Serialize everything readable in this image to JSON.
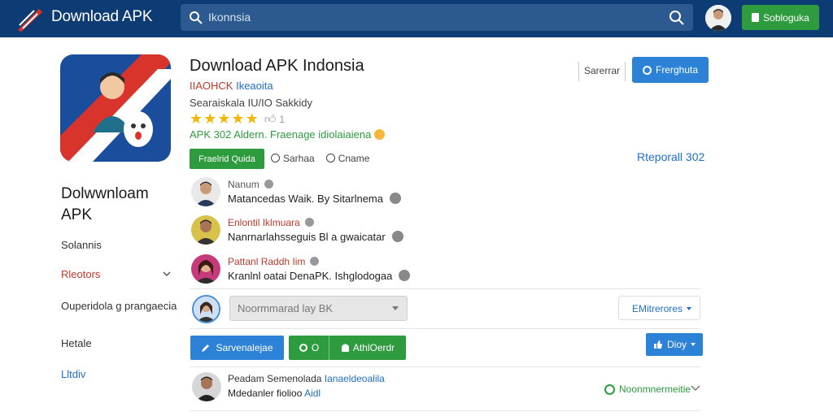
{
  "header": {
    "brand": "Download APK",
    "search_placeholder": "Ikonnsia",
    "account_button": "Sobloguka"
  },
  "app": {
    "title": "Download APK Indonsia",
    "developer_red": "IIAOHCK",
    "developer_blue": "Ikeaoita",
    "meta": "Searaiskala IU/IO Sakkidy",
    "rating_count": "1",
    "tagline": "APK 302 Aldern. Fraenage idiolaiaiena",
    "install_button": "Fraelrid Quida",
    "option_1": "Sarhaa",
    "option_2": "Cname",
    "sort_label": "Sarerrar",
    "primary_button": "Frerghuta",
    "report_link": "Rteporall 302"
  },
  "sidebar": {
    "title": "Dolwwnloam APK",
    "items": [
      {
        "label": "Solannis",
        "color": "default"
      },
      {
        "label": "Rleotors",
        "color": "red"
      },
      {
        "label": "Ouperidola g prangaecia",
        "color": "default"
      },
      {
        "label": "Hetale",
        "color": "default"
      },
      {
        "label": "Lltdiv",
        "color": "blue"
      }
    ]
  },
  "comments": [
    {
      "name": "Nanum",
      "text": "Matancedas Waik. By Sitarlnema",
      "name_color": "default"
    },
    {
      "name": "Enlontil Iklmuara",
      "text": "Nanrnarlahsseguis Bl a gwaicatar",
      "name_color": "red"
    },
    {
      "name": "Pattanl Raddh Iim",
      "text": "Kranlnl oatai DenaPK. Ishglodogaa",
      "name_color": "red"
    }
  ],
  "compose": {
    "select_value": "Noormmarad lay BK",
    "filter_button": "EMitrerores"
  },
  "actions": {
    "blue_button": "Sarvenalejae",
    "green_seg_1": "O",
    "green_seg_2": "AthlOerdr",
    "small_button": "Dioy"
  },
  "latest": {
    "name": "Peadam Semenolada",
    "name_blue": "Ianaeldeoalila",
    "text": "Mdedanler fiolioo",
    "text_blue": "Aidl",
    "status": "Noonmnermeitie"
  },
  "colors": {
    "header_bg": "#0d3b73",
    "accent_green": "#2e9b3e",
    "accent_blue": "#2b82d6",
    "red_text": "#c0392b",
    "star": "#f2b705"
  }
}
